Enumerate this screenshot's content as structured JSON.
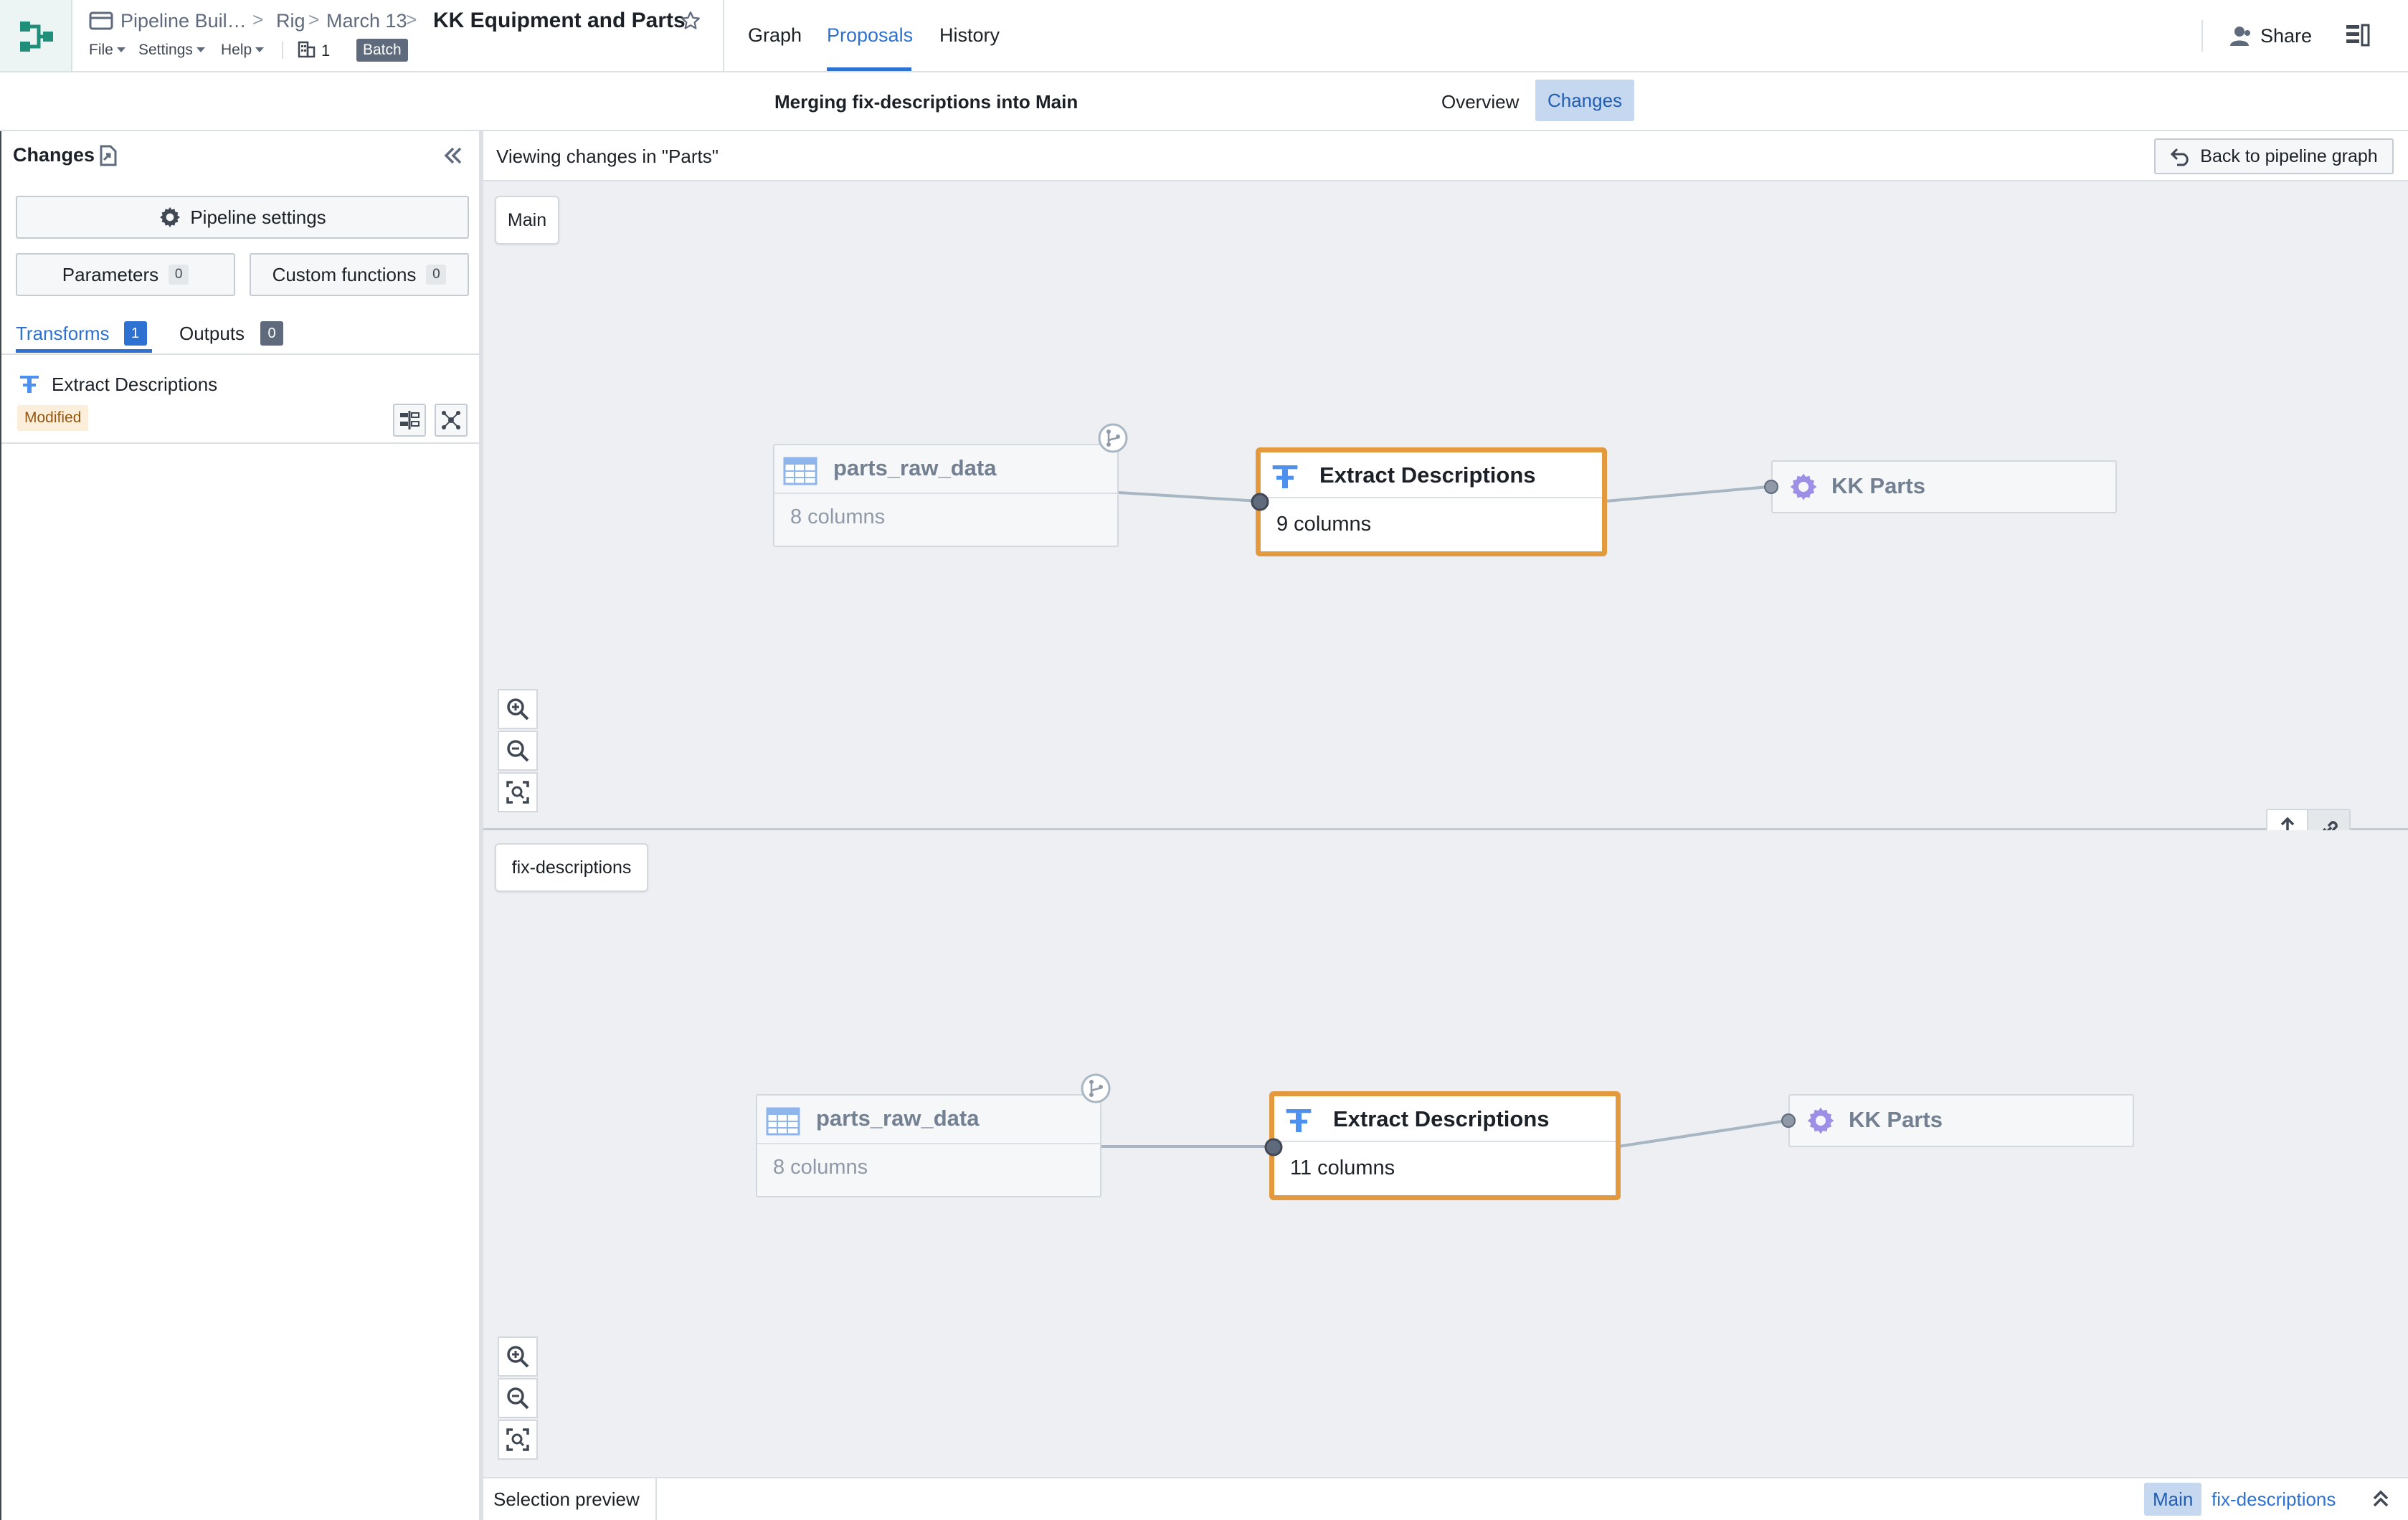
{
  "header": {
    "breadcrumb": [
      "Pipeline Buil…",
      "Rig",
      "March 13"
    ],
    "title": "KK Equipment and Parts",
    "menus": [
      "File",
      "Settings",
      "Help"
    ],
    "branch_count": "1",
    "mode_badge": "Batch",
    "nav_tabs": [
      "Graph",
      "Proposals",
      "History"
    ],
    "active_tab": "Proposals",
    "share_label": "Share"
  },
  "subheader": {
    "merge_text": "Merging fix-descriptions into Main",
    "tabs": [
      "Overview",
      "Changes"
    ],
    "active_tab": "Changes"
  },
  "left_panel": {
    "title": "Changes",
    "pipeline_settings": "Pipeline settings",
    "parameters_label": "Parameters",
    "parameters_count": "0",
    "custom_functions_label": "Custom functions",
    "custom_functions_count": "0",
    "tabs": [
      {
        "label": "Transforms",
        "count": "1"
      },
      {
        "label": "Outputs",
        "count": "0"
      }
    ],
    "items": [
      {
        "name": "Extract Descriptions",
        "status": "Modified"
      }
    ]
  },
  "main": {
    "viewing_text": "Viewing changes in \"Parts\"",
    "back_button": "Back to pipeline graph",
    "panes": [
      {
        "branch": "Main",
        "source": {
          "title": "parts_raw_data",
          "subtitle": "8 columns"
        },
        "transform": {
          "title": "Extract Descriptions",
          "subtitle": "9 columns"
        },
        "output": {
          "title": "KK Parts"
        }
      },
      {
        "branch": "fix-descriptions",
        "source": {
          "title": "parts_raw_data",
          "subtitle": "8 columns"
        },
        "transform": {
          "title": "Extract Descriptions",
          "subtitle": "11 columns"
        },
        "output": {
          "title": "KK Parts"
        }
      }
    ]
  },
  "bottom_bar": {
    "selection_preview": "Selection preview",
    "branches": [
      "Main",
      "fix-descriptions"
    ]
  },
  "colors": {
    "accent": "#2d72d2",
    "selected_outline": "#e39a3f",
    "logo": "#1f8f7a",
    "canvas": "#edeff2",
    "output_gear": "#9d8ee6"
  },
  "icons": [
    "pipeline-logo-icon",
    "folder-icon",
    "star-icon",
    "building-icon",
    "user-icon",
    "sidebar-toggle-icon",
    "file-export-icon",
    "double-chevron-left-icon",
    "gear-icon",
    "transform-icon",
    "compare-icon",
    "graph-layout-icon",
    "dataset-table-icon",
    "branch-icon",
    "zoom-in-icon",
    "zoom-out-icon",
    "fit-view-icon",
    "resize-vertical-icon",
    "link-icon",
    "undo-arrow-icon",
    "chevron-double-up-icon"
  ]
}
